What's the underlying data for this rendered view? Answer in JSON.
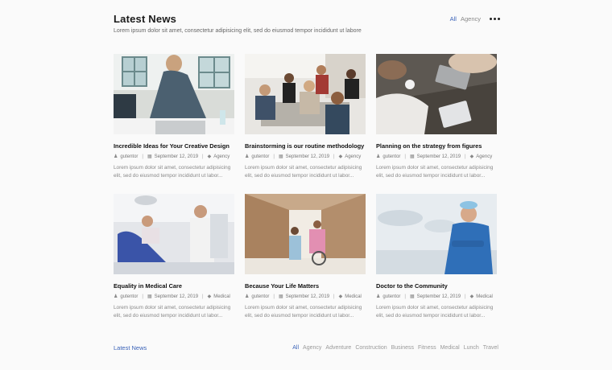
{
  "header": {
    "title": "Latest News",
    "subtitle": "Lorem ipsum dolor sit amet, consectetur adipisicing elit, sed do eiusmod tempor incididunt ut labore",
    "filters": [
      "All",
      "Agency"
    ],
    "active_filter": "All",
    "more_icon": "more-dots-icon"
  },
  "cards": [
    {
      "title": "Incredible Ideas for Your Creative Design",
      "author": "gutentor",
      "date": "September 12, 2019",
      "category": "Agency",
      "excerpt": "Lorem ipsum dolor sit amet, consectetur adipisicing elit, sed do eiusmod tempor incididunt ut labor...",
      "image": "man-with-laptop"
    },
    {
      "title": "Brainstorming is our routine methodology",
      "author": "gutentor",
      "date": "September 12, 2019",
      "category": "Agency",
      "excerpt": "Lorem ipsum dolor sit amet, consectetur adipisicing elit, sed do eiusmod tempor incididunt ut labor...",
      "image": "team-meeting"
    },
    {
      "title": "Planning on the strategy from figures",
      "author": "gutentor",
      "date": "September 12, 2019",
      "category": "Agency",
      "excerpt": "Lorem ipsum dolor sit amet, consectetur adipisicing elit, sed do eiusmod tempor incididunt ut labor...",
      "image": "desk-with-devices"
    },
    {
      "title": "Equality in Medical Care",
      "author": "gutentor",
      "date": "September 12, 2019",
      "category": "Medical",
      "excerpt": "Lorem ipsum dolor sit amet, consectetur adipisicing elit, sed do eiusmod tempor incididunt ut labor...",
      "image": "dentist"
    },
    {
      "title": "Because Your Life Matters",
      "author": "gutentor",
      "date": "September 12, 2019",
      "category": "Medical",
      "excerpt": "Lorem ipsum dolor sit amet, consectetur adipisicing elit, sed do eiusmod tempor incididunt ut labor...",
      "image": "hospital-corridor"
    },
    {
      "title": "Doctor to the Community",
      "author": "gutentor",
      "date": "September 12, 2019",
      "category": "Medical",
      "excerpt": "Lorem ipsum dolor sit amet, consectetur adipisicing elit, sed do eiusmod tempor incididunt ut labor...",
      "image": "surgeon"
    }
  ],
  "footer": {
    "title": "Latest News",
    "filters": [
      "All",
      "Agency",
      "Adventure",
      "Construction",
      "Business",
      "Fitness",
      "Medical",
      "Lunch",
      "Travel"
    ],
    "active_filter": "All"
  },
  "colors": {
    "accent": "#3b63b8",
    "background": "#fafafa"
  }
}
